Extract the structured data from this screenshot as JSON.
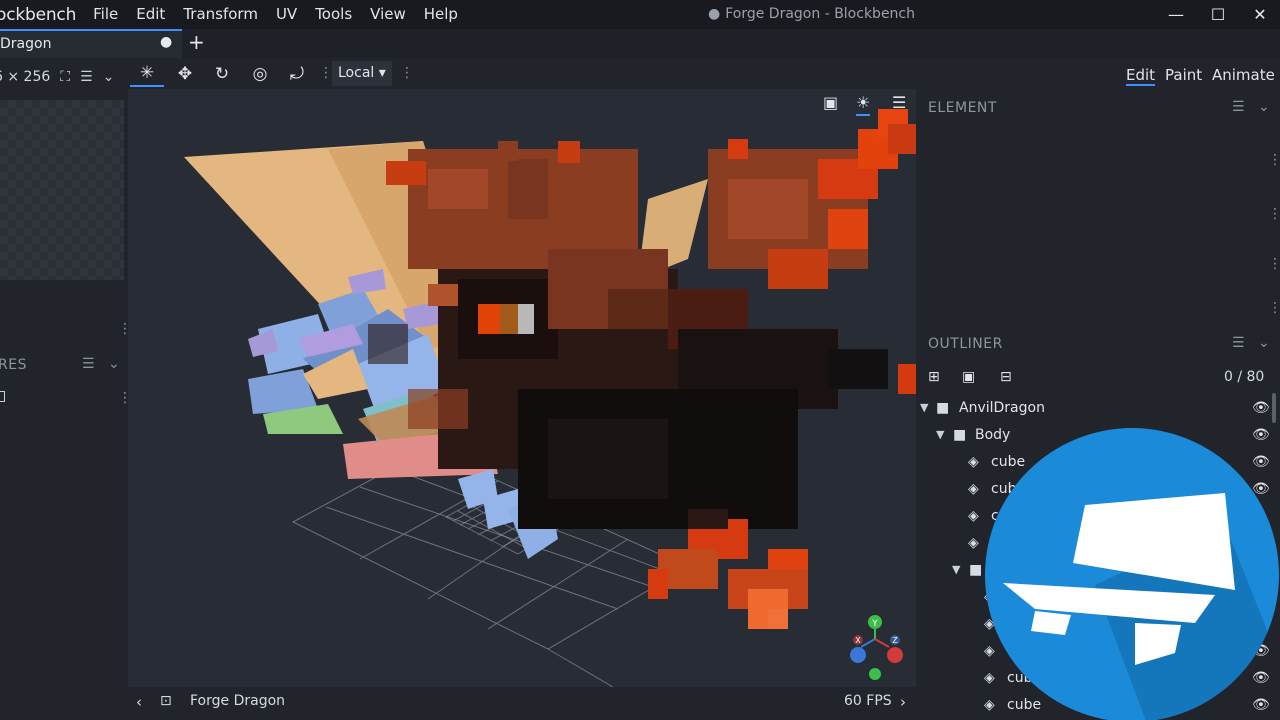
{
  "app": {
    "brand": "ockbench",
    "window_title": "Forge Dragon - Blockbench",
    "title_dot": "●"
  },
  "menu": [
    "File",
    "Edit",
    "Transform",
    "UV",
    "Tools",
    "View",
    "Help"
  ],
  "window_controls": {
    "minimize": "—",
    "maximize": "☐",
    "close": "✕"
  },
  "tab": {
    "label": "Dragon",
    "modified_dot": "●",
    "add": "+"
  },
  "left_panel": {
    "resolution": "6 × 256",
    "textures_title": "RES"
  },
  "toolbar": {
    "tools": [
      {
        "name": "vertex-snap-tool",
        "icon": "✳"
      },
      {
        "name": "move-tool",
        "icon": "✥"
      },
      {
        "name": "rotate-tool",
        "icon": "↻"
      },
      {
        "name": "pivot-tool",
        "icon": "◎"
      },
      {
        "name": "resize-tool",
        "icon": "⤾"
      }
    ],
    "transform_space": "Local",
    "transform_space_arrow": "▾"
  },
  "modes": [
    "Edit",
    "Paint",
    "Animate"
  ],
  "active_mode": "Edit",
  "viewport": {
    "model_name": "Forge Dragon",
    "fps": "60 FPS",
    "axis_labels": {
      "y": "Y",
      "x": "X",
      "z": "Z"
    }
  },
  "element_panel": {
    "title": "ELEMENT"
  },
  "outliner": {
    "title": "OUTLINER",
    "count": "0 / 80",
    "rows": [
      {
        "label": "AnvilDragon",
        "type": "group",
        "depth": 0
      },
      {
        "label": "Body",
        "type": "group",
        "depth": 1
      },
      {
        "label": "cube",
        "type": "cube",
        "depth": 2
      },
      {
        "label": "cube",
        "type": "cube",
        "depth": 2
      },
      {
        "label": "cube",
        "type": "cube",
        "depth": 2
      },
      {
        "label": "cube",
        "type": "cube",
        "depth": 2
      },
      {
        "label": "",
        "type": "group",
        "depth": 1
      },
      {
        "label": "cube",
        "type": "cube",
        "depth": 2
      },
      {
        "label": "cube",
        "type": "cube",
        "depth": 2
      },
      {
        "label": "cube",
        "type": "cube",
        "depth": 2
      },
      {
        "label": "cube",
        "type": "cube",
        "depth": 2
      },
      {
        "label": "cube",
        "type": "cube",
        "depth": 2
      }
    ]
  },
  "colors": {
    "accent": "#3e90ff",
    "logo_blue": "#1b8ad8"
  }
}
